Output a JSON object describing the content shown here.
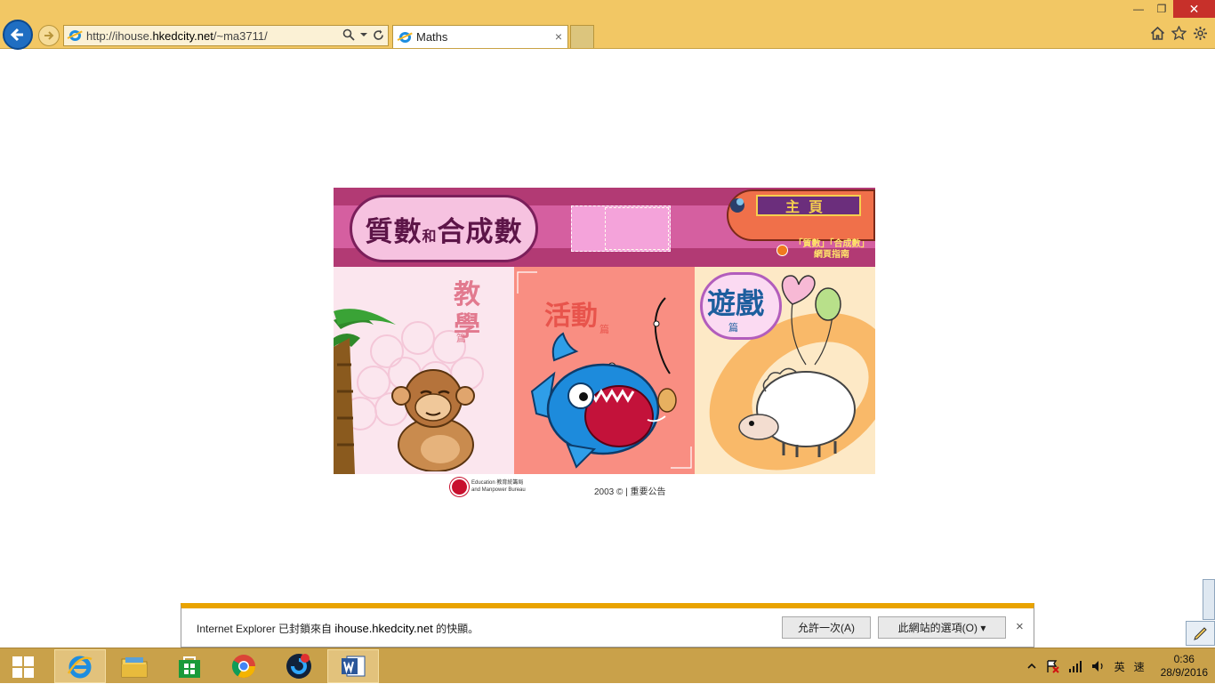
{
  "browser": {
    "url_prefix": "http://ihouse.",
    "url_domain": "hkedcity.net",
    "url_suffix": "/~ma3711/",
    "tab_title": "Maths",
    "tab_close": "×",
    "window_close": "✕",
    "window_minimize": "—",
    "window_restore": "❐"
  },
  "page": {
    "title_part1": "質數",
    "title_part2": "和",
    "title_part3": "合成數",
    "home_label": "主頁",
    "guide_line1": "「質數」「合成數」",
    "guide_line2": "網頁指南",
    "teach_label": "教學",
    "teach_sub": "篇",
    "activity_label": "活動",
    "activity_sub": "篇",
    "game_label": "遊戲",
    "game_sub": "篇",
    "edb_line1": "Education 教育統籌局",
    "edb_line2": "and Manpower Bureau",
    "copyright": "2003 © | 重要公告"
  },
  "notification": {
    "text_prefix": "Internet Explorer 已封鎖來自 ",
    "text_domain": "ihouse.hkedcity.net",
    "text_suffix": " 的快顯。",
    "allow_once": "允許一次(A)",
    "site_options": "此網站的選項(O) ▾",
    "close": "×"
  },
  "taskbar": {
    "ime_lang": "英",
    "ime_mode": "速",
    "time": "0:36",
    "date": "28/9/2016"
  },
  "colors": {
    "chrome": "#f2c764",
    "taskbar": "#c9a14a",
    "notify_accent": "#e9a300",
    "banner": "#b23a74"
  }
}
